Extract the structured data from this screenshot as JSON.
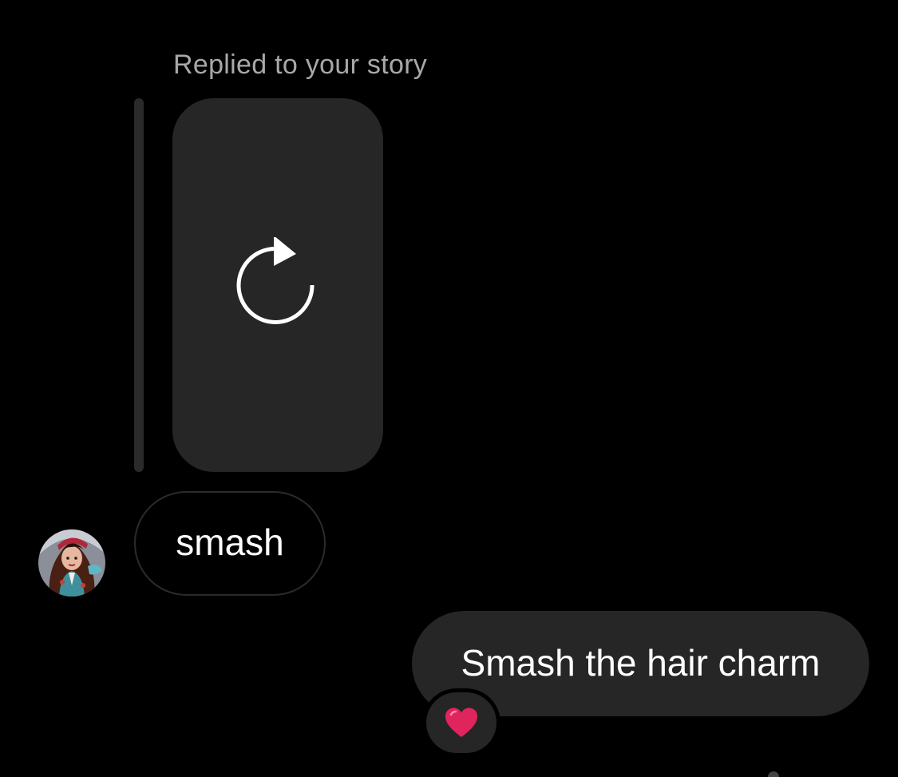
{
  "thread": {
    "reply_context": "Replied to your story",
    "story_preview": {
      "icon": "reload-icon",
      "status": "unavailable"
    },
    "incoming_message": {
      "text": "smash",
      "sender_avatar": "avatar"
    },
    "outgoing_message": {
      "text": "Smash the hair charm",
      "reaction": "❤️"
    }
  },
  "colors": {
    "background": "#000000",
    "bubble": "#262626",
    "secondary_text": "#a8a8a8",
    "reaction_heart": "#e0245e"
  }
}
